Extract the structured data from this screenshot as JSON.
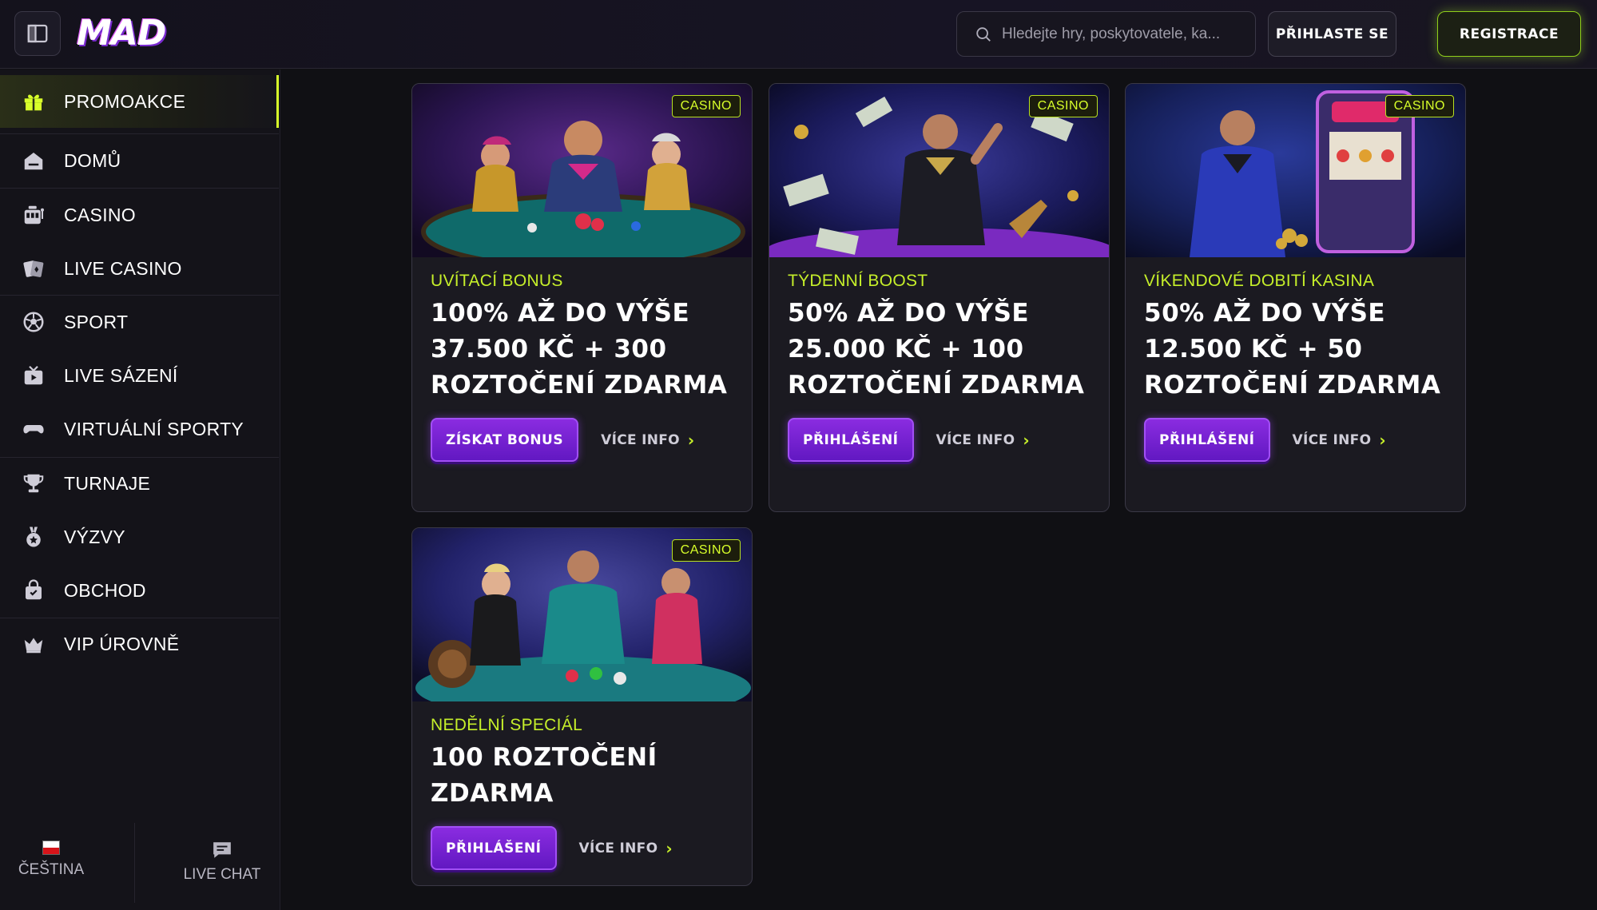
{
  "header": {
    "logo": "MAD",
    "search_placeholder": "Hledejte hry, poskytovatele, ka...",
    "login_label": "PŘIHLASTE SE",
    "register_label": "REGISTRACE"
  },
  "sidebar": {
    "items": [
      {
        "label": "PROMOAKCE",
        "icon": "gift-icon",
        "active": true
      },
      {
        "label": "DOMŮ",
        "icon": "home-icon"
      },
      {
        "label": "CASINO",
        "icon": "slot-machine-icon"
      },
      {
        "label": "LIVE CASINO",
        "icon": "cards-icon"
      },
      {
        "label": "SPORT",
        "icon": "soccer-ball-icon"
      },
      {
        "label": "LIVE SÁZENÍ",
        "icon": "tv-icon"
      },
      {
        "label": "VIRTUÁLNÍ SPORTY",
        "icon": "gamepad-icon"
      },
      {
        "label": "TURNAJE",
        "icon": "trophy-icon"
      },
      {
        "label": "VÝZVY",
        "icon": "medal-icon"
      },
      {
        "label": "OBCHOD",
        "icon": "shopping-bag-icon"
      },
      {
        "label": "VIP ÚROVNĚ",
        "icon": "crown-icon"
      }
    ],
    "footer": {
      "language_label": "ČEŠTINA",
      "chat_label": "LIVE CHAT"
    }
  },
  "promos": [
    {
      "badge": "CASINO",
      "subtitle": "UVÍTACÍ BONUS",
      "title": "100% AŽ DO VÝŠE 37.500 KČ + 300 ROZTOČENÍ ZDARMA",
      "primary_label": "ZÍSKAT BONUS",
      "more_label": "VÍCE INFO"
    },
    {
      "badge": "CASINO",
      "subtitle": "TÝDENNÍ BOOST",
      "title": "50% AŽ DO VÝŠE 25.000 KČ + 100 ROZTOČENÍ ZDARMA",
      "primary_label": "PŘIHLÁŠENÍ",
      "more_label": "VÍCE INFO"
    },
    {
      "badge": "CASINO",
      "subtitle": "VÍKENDOVÉ DOBITÍ KASINA",
      "title": "50% AŽ DO VÝŠE 12.500 KČ + 50 ROZTOČENÍ ZDARMA",
      "primary_label": "PŘIHLÁŠENÍ",
      "more_label": "VÍCE INFO"
    },
    {
      "badge": "CASINO",
      "subtitle": "NEDĚLNÍ SPECIÁL",
      "title": "100 ROZTOČENÍ ZDARMA",
      "primary_label": "PŘIHLÁŠENÍ",
      "more_label": "VÍCE INFO"
    }
  ],
  "colors": {
    "accent_lime": "#d8ff2a",
    "button_purple": "#7a24d6",
    "background": "#101014"
  }
}
